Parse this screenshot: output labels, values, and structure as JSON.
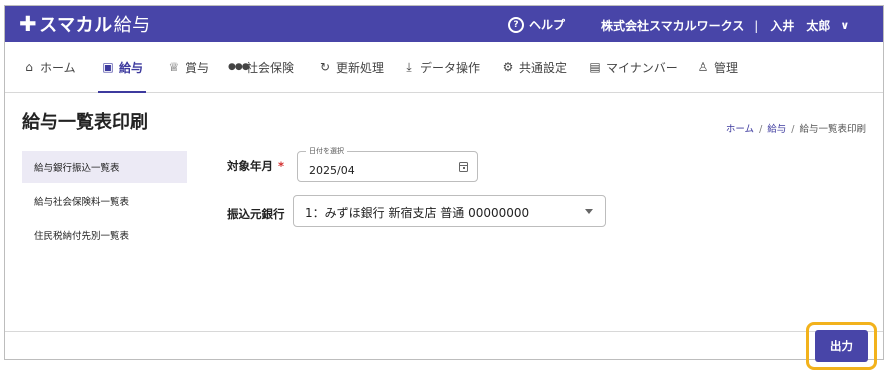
{
  "header": {
    "logo_plus": "✚",
    "logo_main": "スマカル",
    "logo_sub": "給与",
    "help_label": "ヘルプ",
    "company": "株式会社スマカルワークス",
    "separator": "|",
    "user": "入井　太郎"
  },
  "nav": {
    "items": [
      {
        "label": "ホーム",
        "icon": "home-icon",
        "glyph": "⌂"
      },
      {
        "label": "給与",
        "icon": "payroll-icon",
        "glyph": "▣"
      },
      {
        "label": "賞与",
        "icon": "trophy-icon",
        "glyph": "♕"
      },
      {
        "label": "社会保険",
        "icon": "people-icon",
        "glyph": "👥"
      },
      {
        "label": "更新処理",
        "icon": "refresh-icon",
        "glyph": "↻"
      },
      {
        "label": "データ操作",
        "icon": "download-icon",
        "glyph": "⤓"
      },
      {
        "label": "共通設定",
        "icon": "gear-icon",
        "glyph": "⚙"
      },
      {
        "label": "マイナンバー",
        "icon": "card-icon",
        "glyph": "▤"
      },
      {
        "label": "管理",
        "icon": "user-icon",
        "glyph": "♙"
      }
    ],
    "active_index": 1
  },
  "page": {
    "title": "給与一覧表印刷",
    "breadcrumb": [
      "ホーム",
      "給与",
      "給与一覧表印刷"
    ]
  },
  "sidebar": {
    "items": [
      {
        "label": "給与銀行振込一覧表"
      },
      {
        "label": "給与社会保険料一覧表"
      },
      {
        "label": "住民税納付先別一覧表"
      }
    ],
    "selected_index": 0
  },
  "form": {
    "target_month_label": "対象年月",
    "required_mark": "*",
    "date_legend": "日付を選択",
    "date_value": "2025/04",
    "bank_label": "振込元銀行",
    "bank_value": "1：みずほ銀行 新宿支店 普通 00000000"
  },
  "footer": {
    "output_label": "出力"
  },
  "colors": {
    "primary": "#4845a8",
    "active_nav": "#3d3a9e",
    "selected_side": "#eceaf5",
    "highlight": "#f2b21c",
    "required": "#d32f2f"
  }
}
